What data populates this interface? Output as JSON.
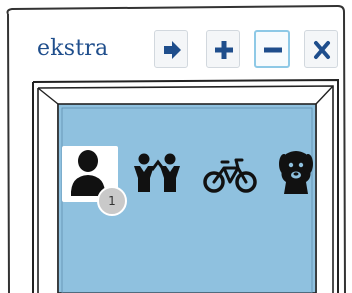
{
  "panel": {
    "title": "ekstra",
    "accent_color": "#1f4e8c",
    "tile_color": "#8fc1df"
  },
  "toolbar": {
    "buttons": [
      {
        "icon": "arrow-right-icon",
        "active": false
      },
      {
        "icon": "plus-icon",
        "active": false
      },
      {
        "icon": "minus-icon",
        "active": true
      },
      {
        "icon": "close-icon",
        "active": false
      }
    ]
  },
  "tiles": [
    {
      "icon": "person-icon",
      "selected": true,
      "badge": "1"
    },
    {
      "icon": "children-icon",
      "selected": false
    },
    {
      "icon": "bicycle-icon",
      "selected": false
    },
    {
      "icon": "dog-icon",
      "selected": false
    }
  ]
}
